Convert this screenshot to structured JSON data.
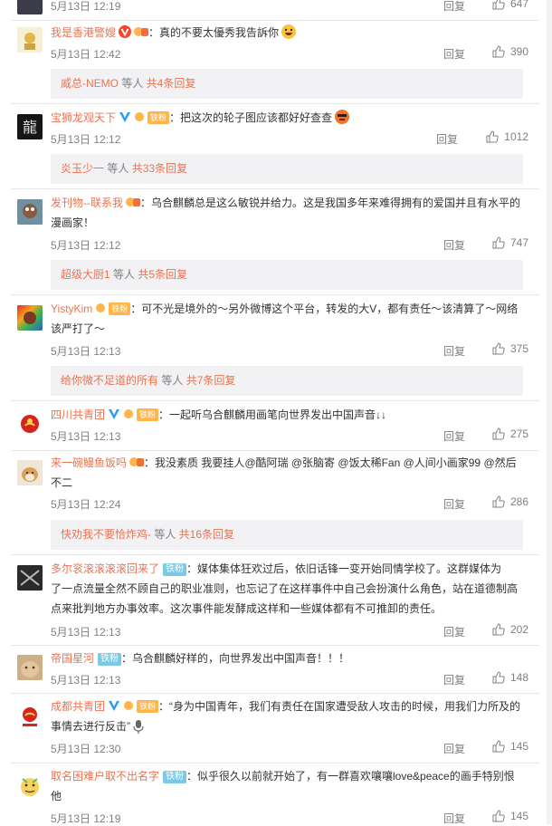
{
  "comments": [
    {
      "user": "",
      "text": "",
      "time": "5月13日 12:19",
      "reply": "回复",
      "likes": "647"
    },
    {
      "user": "我是香港警嫂",
      "text": "：真的不要太優秀我告訴你",
      "time": "5月13日 12:42",
      "reply": "回复",
      "likes": "390",
      "sub": {
        "name": "威总-NEMO",
        "mid": " 等人 ",
        "count": "共4条回复"
      }
    },
    {
      "user": "宝狮龙观天下",
      "badge": "铁粉",
      "text": "：把这次的轮子图应该都好好查查",
      "time": "5月13日 12:12",
      "reply": "回复",
      "likes": "1012",
      "sub": {
        "name": "炎玉少一",
        "mid": " 等人 ",
        "count": "共33条回复"
      }
    },
    {
      "user": "发刊物--联系我",
      "text": "：乌合麒麟总是这么敏锐并给力。这是我国多年来难得拥有的爱国并且有水平的",
      "text2": "漫画家！",
      "time": "5月13日 12:12",
      "reply": "回复",
      "likes": "747",
      "sub": {
        "name": "超级大厨1",
        "mid": " 等人 ",
        "count": "共5条回复"
      }
    },
    {
      "user": "YistyKim",
      "badge": "铁粉",
      "text": "：可不光是境外的～另外微博这个平台，转发的大V，都有责任～该清算了～网络",
      "text2": "该严打了～",
      "time": "5月13日 12:13",
      "reply": "回复",
      "likes": "375",
      "sub": {
        "name": "给你微不足道的所有",
        "mid": " 等人 ",
        "count": "共7条回复"
      }
    },
    {
      "user": "四川共青团",
      "badge": "铁粉",
      "text": "：一起听乌合麒麟用画笔向世界发出中国声音↓↓",
      "time": "5月13日 12:13",
      "reply": "回复",
      "likes": "275"
    },
    {
      "user": "来一碗鳗鱼饭吗",
      "text": "：我没素质 我要挂人@酷阿瑞 @张脑寄 @饭太稀Fan @人间小画家99 @然后",
      "text2": "不二",
      "time": "5月13日 12:24",
      "reply": "回复",
      "likes": "286",
      "sub": {
        "name": "快劝我不要恰炸鸡-",
        "mid": " 等人 ",
        "count": "共16条回复"
      }
    },
    {
      "user": "多尔衮滚滚滚滚回来了",
      "badge": "铁粉",
      "text": "：媒体集体狂欢过后，依旧话锋一变开始同情学校了。这群媒体为",
      "text2": "了一点流量全然不顾自己的职业准则，也忘记了在这样事件中自己会扮演什么角色，站在道德制高",
      "text3": "点来批判地方办事效率。这次事件能发酵成这样和一些媒体都有不可推卸的责任。",
      "time": "5月13日 12:13",
      "reply": "回复",
      "likes": "202"
    },
    {
      "user": "帝国星河",
      "badge": "铁粉",
      "text": "：乌合麒麟好样的，向世界发出中国声音！！！",
      "time": "5月13日 12:13",
      "reply": "回复",
      "likes": "148"
    },
    {
      "user": "成都共青团",
      "badge": "铁粉",
      "text": "：“身为中国青年，我们有责任在国家遭受敌人攻击的时候，用我们力所及的",
      "text2": "事情去进行反击”",
      "time": "5月13日 12:30",
      "reply": "回复",
      "likes": "145"
    },
    {
      "user": "取名困难户取不出名字",
      "badge": "铁粉",
      "text": "：似乎很久以前就开始了，有一群喜欢嚷嚷love&peace的画手特别恨",
      "text2": "他",
      "time": "5月13日 12:19",
      "reply": "回复",
      "likes": "145"
    }
  ],
  "colors": {
    "link": "#eb7350",
    "meta": "#808080",
    "sub_bg": "#f2f2f5"
  }
}
